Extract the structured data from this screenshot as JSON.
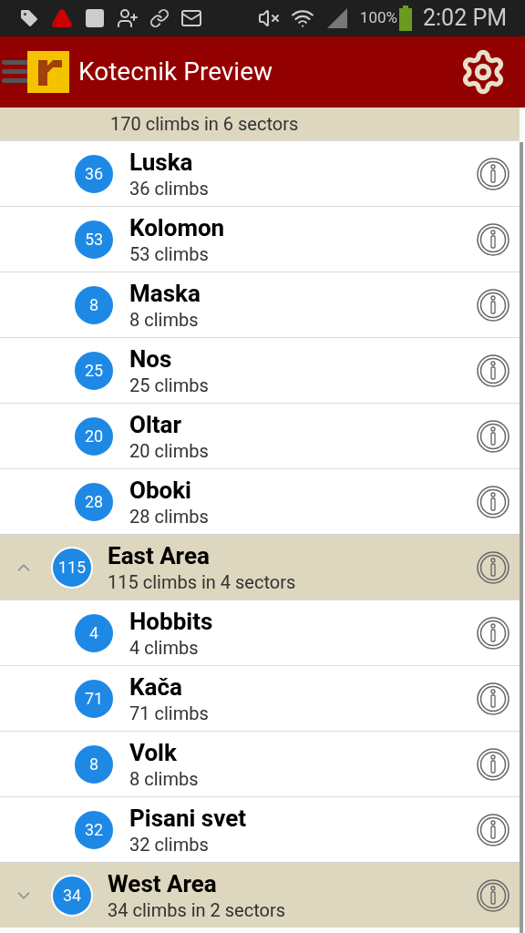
{
  "status_bar": {
    "battery": "100%",
    "time": "2:02 PM"
  },
  "app_bar": {
    "title": "Kotecnik Preview"
  },
  "areas": [
    {
      "subtitle": "170 climbs in 6 sectors",
      "sectors": [
        {
          "count": "36",
          "name": "Luska",
          "subtitle": "36 climbs"
        },
        {
          "count": "53",
          "name": "Kolomon",
          "subtitle": "53 climbs"
        },
        {
          "count": "8",
          "name": "Maska",
          "subtitle": "8 climbs"
        },
        {
          "count": "25",
          "name": "Nos",
          "subtitle": "25 climbs"
        },
        {
          "count": "20",
          "name": "Oltar",
          "subtitle": "20 climbs"
        },
        {
          "count": "28",
          "name": "Oboki",
          "subtitle": "28 climbs"
        }
      ]
    },
    {
      "count": "115",
      "name": "East Area",
      "subtitle": "115 climbs in 4 sectors",
      "expanded": true,
      "sectors": [
        {
          "count": "4",
          "name": "Hobbits",
          "subtitle": "4 climbs"
        },
        {
          "count": "71",
          "name": "Kača",
          "subtitle": "71 climbs"
        },
        {
          "count": "8",
          "name": "Volk",
          "subtitle": "8 climbs"
        },
        {
          "count": "32",
          "name": "Pisani svet",
          "subtitle": "32 climbs"
        }
      ]
    },
    {
      "count": "34",
      "name": "West Area",
      "subtitle": "34 climbs in 2 sectors",
      "expanded": false
    }
  ]
}
